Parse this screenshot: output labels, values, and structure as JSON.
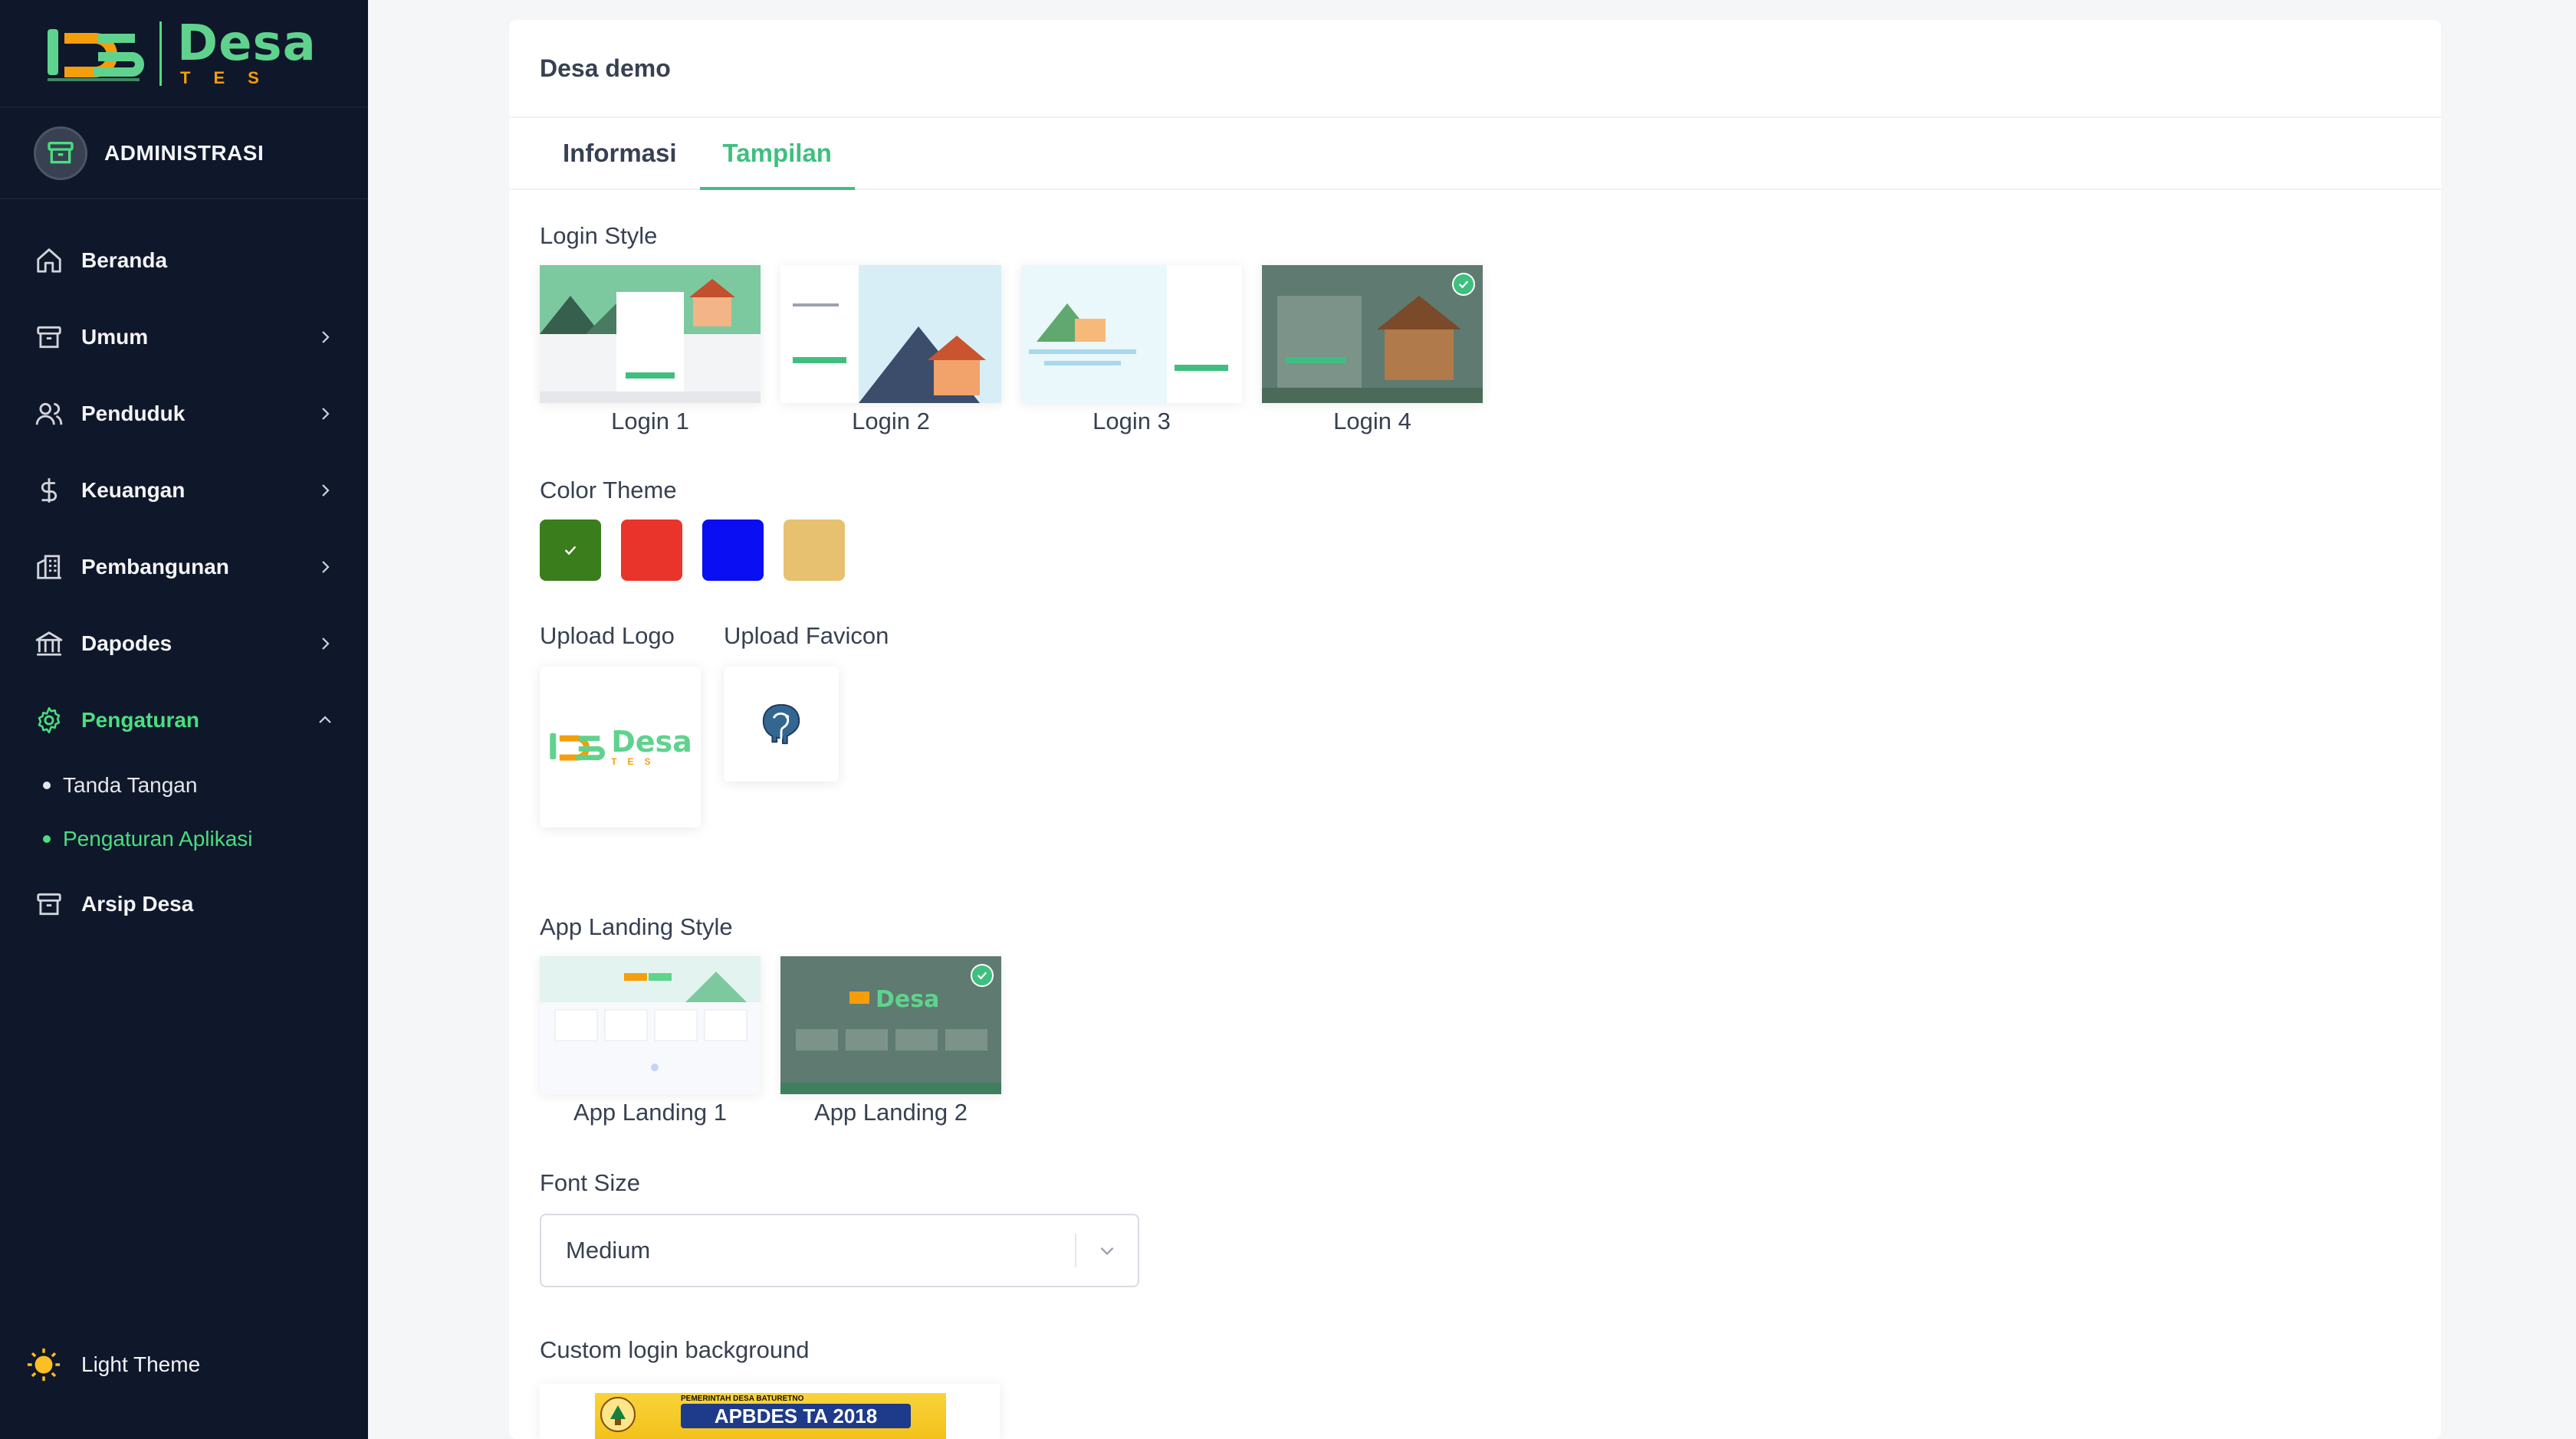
{
  "brand": {
    "name": "Desa",
    "sub": "TES"
  },
  "sidebar": {
    "role": "ADMINISTRASI",
    "items": [
      {
        "label": "Beranda",
        "icon": "home-icon",
        "chevron": false
      },
      {
        "label": "Umum",
        "icon": "archive-icon",
        "chevron": true
      },
      {
        "label": "Penduduk",
        "icon": "users-icon",
        "chevron": true
      },
      {
        "label": "Keuangan",
        "icon": "dollar-icon",
        "chevron": true
      },
      {
        "label": "Pembangunan",
        "icon": "building-icon",
        "chevron": true
      },
      {
        "label": "Dapodes",
        "icon": "bank-icon",
        "chevron": true
      },
      {
        "label": "Pengaturan",
        "icon": "gear-icon",
        "chevron": true,
        "expanded": true
      },
      {
        "label": "Arsip Desa",
        "icon": "archive-icon",
        "chevron": false
      }
    ],
    "submenu": [
      {
        "label": "Tanda Tangan"
      },
      {
        "label": "Pengaturan Aplikasi",
        "active": true
      }
    ],
    "theme_label": "Light Theme"
  },
  "main": {
    "title": "Desa demo",
    "tabs": [
      {
        "label": "Informasi"
      },
      {
        "label": "Tampilan",
        "active": true
      }
    ],
    "login_style": {
      "label": "Login Style",
      "options": [
        {
          "label": "Login 1"
        },
        {
          "label": "Login 2"
        },
        {
          "label": "Login 3"
        },
        {
          "label": "Login 4",
          "selected": true
        }
      ]
    },
    "color_theme": {
      "label": "Color Theme",
      "colors": [
        "#3a7d1c",
        "#e8342a",
        "#0a0ef2",
        "#e8c170"
      ],
      "selected_index": 0
    },
    "upload_logo": {
      "label": "Upload Logo",
      "logo_text": "Desa",
      "logo_sub": "TES"
    },
    "upload_favicon": {
      "label": "Upload Favicon"
    },
    "app_landing": {
      "label": "App Landing Style",
      "options": [
        {
          "label": "App Landing 1"
        },
        {
          "label": "App Landing 2",
          "selected": true
        }
      ],
      "preview_brand": "Desa"
    },
    "font_size": {
      "label": "Font Size",
      "value": "Medium"
    },
    "custom_bg": {
      "label": "Custom login background",
      "banner_title": "APBDES TA 2018",
      "banner_top": "PEMERINTAH DESA BATURETNO"
    }
  }
}
